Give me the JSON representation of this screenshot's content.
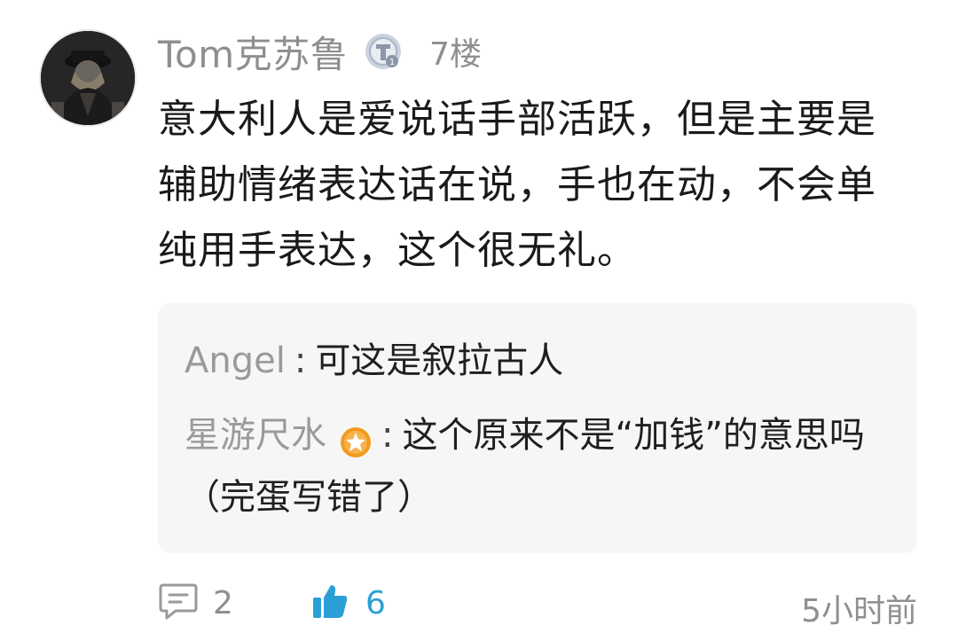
{
  "post": {
    "username": "Tom克苏鲁",
    "level_icon": "level-t1-badge-icon",
    "floor": "7楼",
    "content": "意大利人是爱说话手部活跃，但是主要是辅助情绪表达话在说，手也在动，不会单纯用手表达，这个很无礼。"
  },
  "replies": [
    {
      "name": "Angel",
      "separator": ":",
      "text": "可这是叙拉古人"
    },
    {
      "name": "星游尺水",
      "badge_icon": "star-badge-icon",
      "separator": ":",
      "text": "这个原来不是“加钱”的意思吗（完蛋写错了）"
    }
  ],
  "footer": {
    "comment_icon": "comment-icon",
    "comment_count": "2",
    "like_icon": "thumbs-up-icon",
    "like_count": "6",
    "time": "5小时前"
  },
  "colors": {
    "muted_text": "#8f8f8f",
    "accent": "#2a9fd6",
    "badge_orange": "#f39a1e",
    "reply_bg": "#f6f6f6"
  }
}
